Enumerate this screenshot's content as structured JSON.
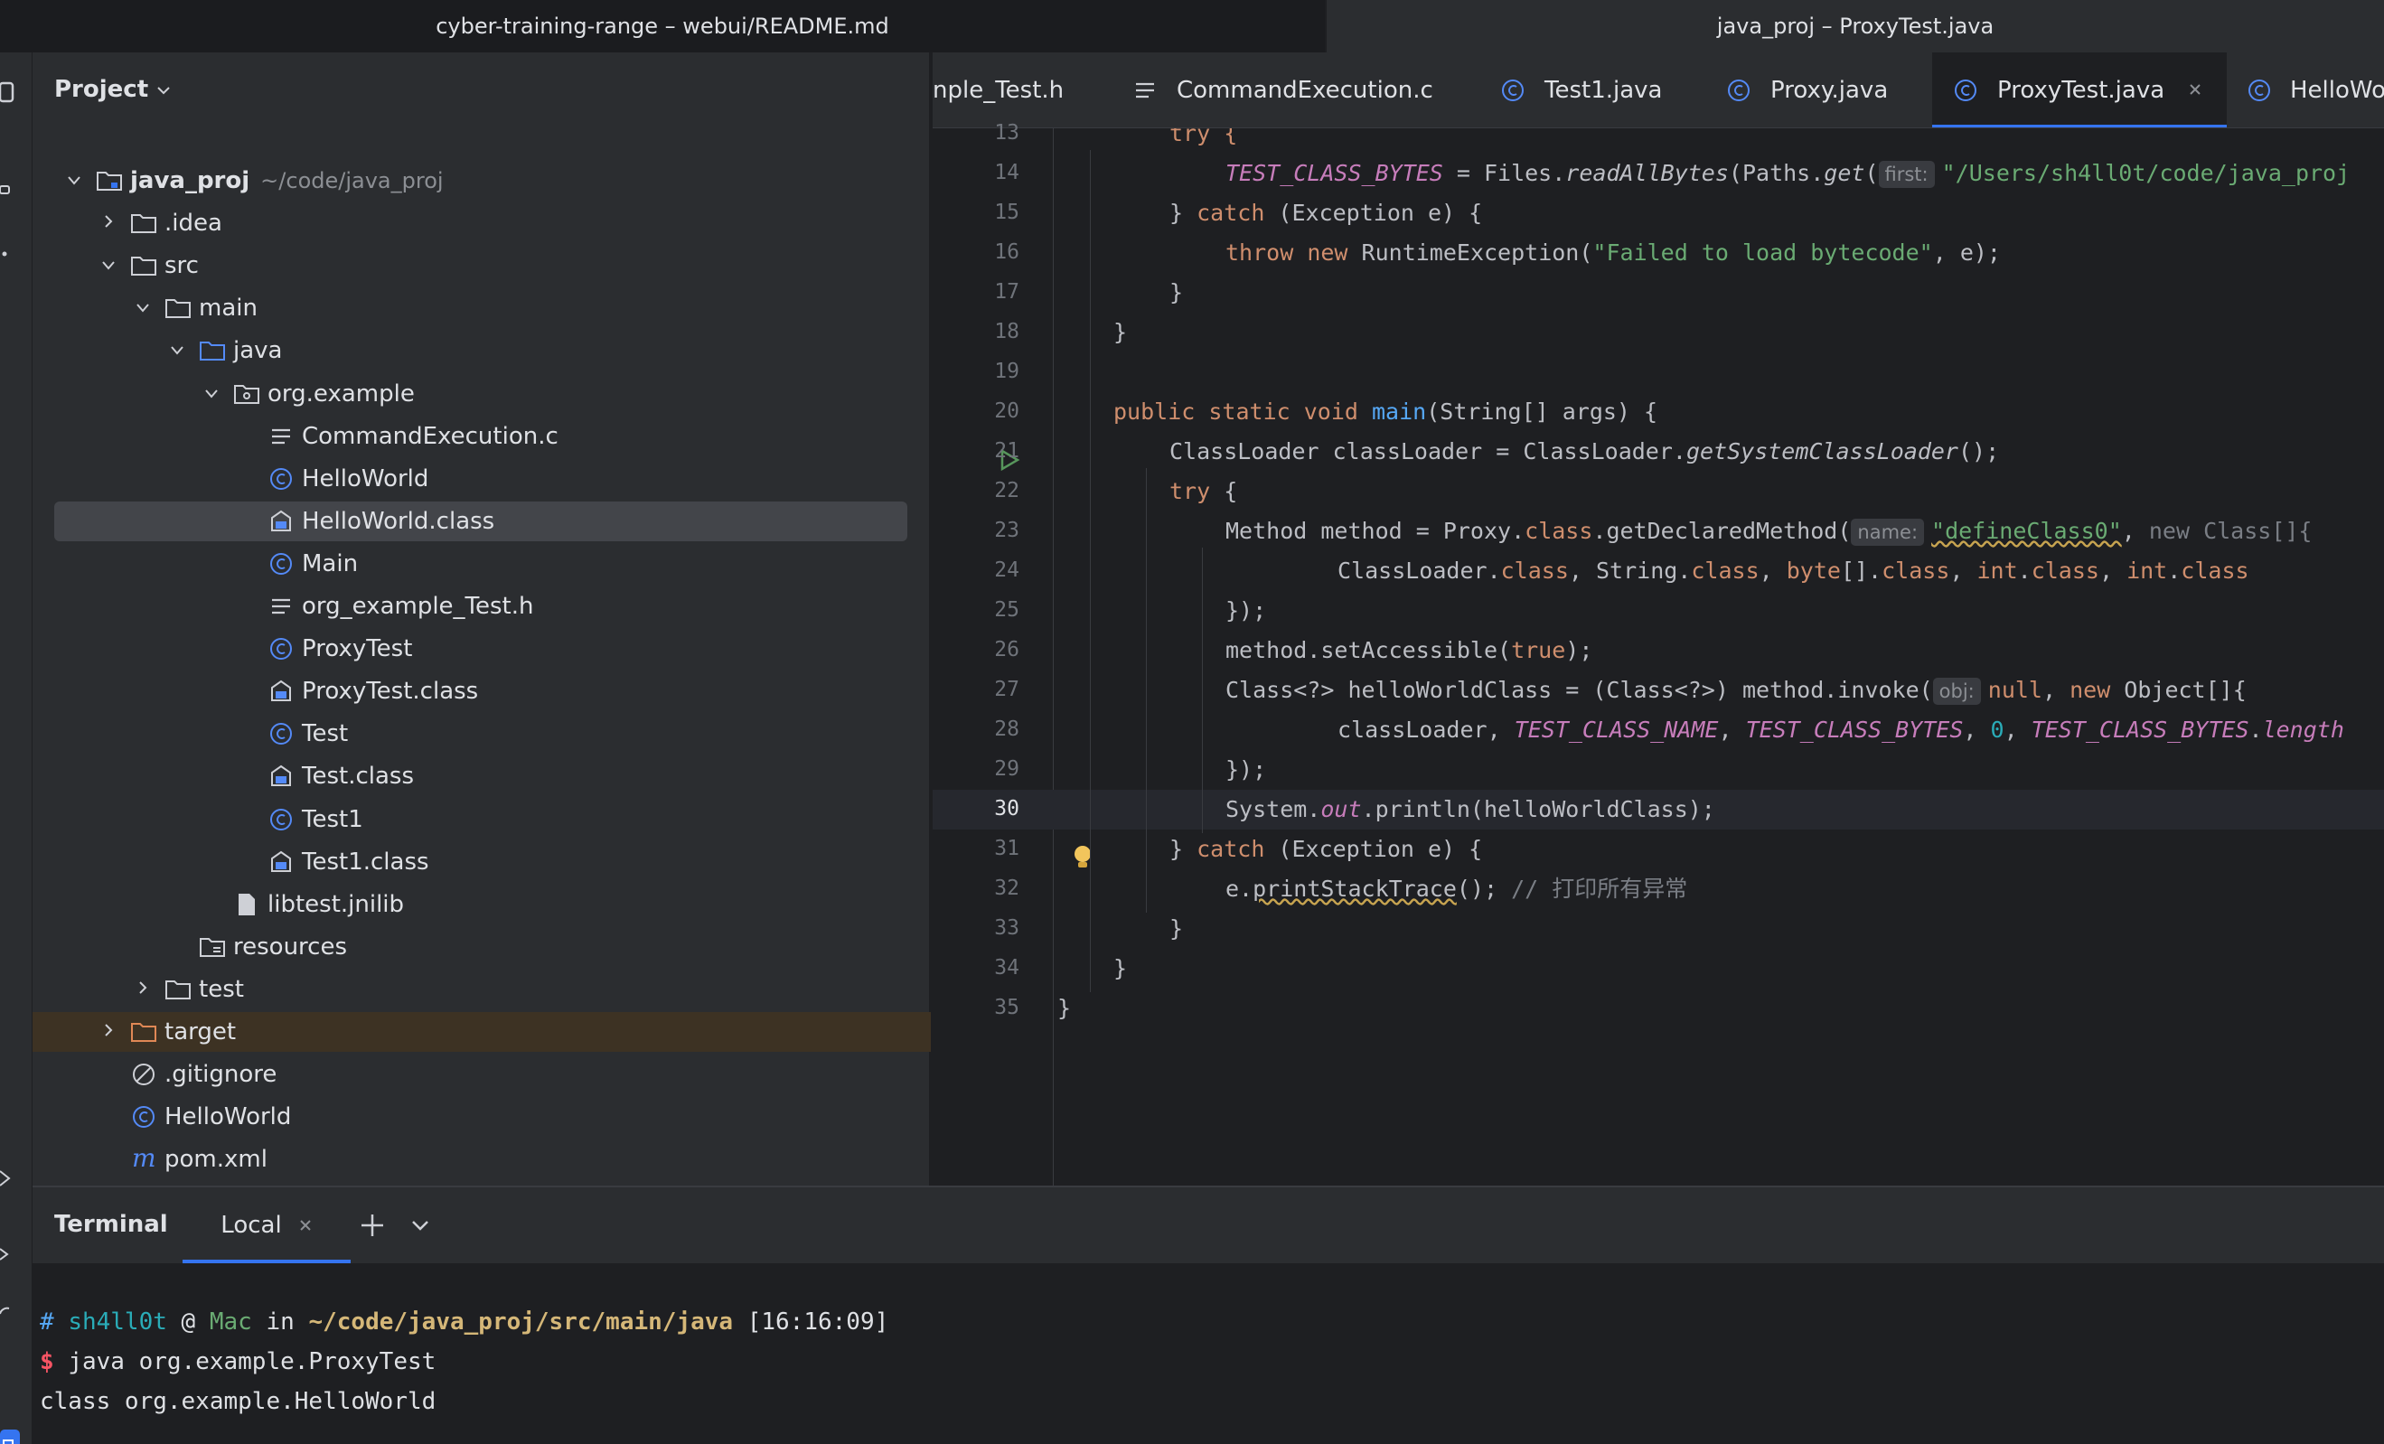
{
  "windows": {
    "left_title": "cyber-training-range – webui/README.md",
    "right_title": "java_proj – ProxyTest.java"
  },
  "project_panel": {
    "title": "Project",
    "tree": [
      {
        "label": "java_proj",
        "extra": "~/code/java_proj",
        "icon": "module-folder-icon",
        "chevron": "down",
        "indent": 0,
        "bold": true
      },
      {
        "label": ".idea",
        "icon": "folder-icon",
        "chevron": "right",
        "indent": 1
      },
      {
        "label": "src",
        "icon": "folder-icon",
        "chevron": "down",
        "indent": 1
      },
      {
        "label": "main",
        "icon": "folder-icon",
        "chevron": "down",
        "indent": 2
      },
      {
        "label": "java",
        "icon": "source-folder-icon",
        "chevron": "down",
        "indent": 3
      },
      {
        "label": "org.example",
        "icon": "package-icon",
        "chevron": "down",
        "indent": 4
      },
      {
        "label": "CommandExecution.c",
        "icon": "text-file-icon",
        "indent": 5
      },
      {
        "label": "HelloWorld",
        "icon": "java-class-icon",
        "indent": 5
      },
      {
        "label": "HelloWorld.class",
        "icon": "binary-class-icon",
        "indent": 5,
        "selected": true
      },
      {
        "label": "Main",
        "icon": "java-class-icon",
        "indent": 5
      },
      {
        "label": "org_example_Test.h",
        "icon": "text-file-icon",
        "indent": 5
      },
      {
        "label": "ProxyTest",
        "icon": "java-class-icon",
        "indent": 5
      },
      {
        "label": "ProxyTest.class",
        "icon": "binary-class-icon",
        "indent": 5
      },
      {
        "label": "Test",
        "icon": "java-class-icon",
        "indent": 5
      },
      {
        "label": "Test.class",
        "icon": "binary-class-icon",
        "indent": 5
      },
      {
        "label": "Test1",
        "icon": "java-class-icon",
        "indent": 5
      },
      {
        "label": "Test1.class",
        "icon": "binary-class-icon",
        "indent": 5
      },
      {
        "label": "libtest.jnilib",
        "icon": "file-icon",
        "indent": 4
      },
      {
        "label": "resources",
        "icon": "resources-folder-icon",
        "indent": 3
      },
      {
        "label": "test",
        "icon": "folder-icon",
        "chevron": "right",
        "indent": 2
      },
      {
        "label": "target",
        "icon": "excluded-folder-icon",
        "chevron": "right",
        "indent": 1,
        "highlight": true
      },
      {
        "label": ".gitignore",
        "icon": "ignore-file-icon",
        "indent": 1
      },
      {
        "label": "HelloWorld",
        "icon": "java-class-icon",
        "indent": 1
      },
      {
        "label": "pom.xml",
        "icon": "maven-icon",
        "indent": 1
      }
    ]
  },
  "editor": {
    "tabs": [
      {
        "label": "nple_Test.h",
        "icon": "none"
      },
      {
        "label": "CommandExecution.c",
        "icon": "text-file-icon"
      },
      {
        "label": "Test1.java",
        "icon": "java-class-icon"
      },
      {
        "label": "Proxy.java",
        "icon": "java-class-icon"
      },
      {
        "label": "ProxyTest.java",
        "icon": "java-class-icon",
        "active": true
      },
      {
        "label": "HelloWorld",
        "icon": "java-class-icon"
      }
    ],
    "current_line": "30",
    "line_numbers": [
      "13",
      "14",
      "15",
      "16",
      "17",
      "18",
      "19",
      "20",
      "21",
      "22",
      "23",
      "24",
      "25",
      "26",
      "27",
      "28",
      "29",
      "30",
      "31",
      "32",
      "33",
      "34",
      "35"
    ],
    "code": {
      "l13_try": "try {",
      "l14_field": "TEST_CLASS_BYTES",
      "l14_a": " = Files.",
      "l14_m1": "readAllBytes",
      "l14_b": "(Paths.",
      "l14_m2": "get",
      "l14_c": "(",
      "l14_hint": "first:",
      "l14_str": "\"/Users/sh4ll0t/code/java_proj",
      "l15_a": "} ",
      "l15_kw": "catch",
      "l15_b": " (Exception e) {",
      "l16_kw1": "throw",
      "l16_kw2": "new",
      "l16_a": " RuntimeException(",
      "l16_str": "\"Failed to load bytecode\"",
      "l16_b": ", e);",
      "l17": "}",
      "l18": "}",
      "l20_kw": "public static void",
      "l20_m": "main",
      "l20_b": "(String[] args) {",
      "l21_a": "ClassLoader classLoader = ClassLoader.",
      "l21_m": "getSystemClassLoader",
      "l21_b": "();",
      "l22_kw": "try",
      "l22_b": " {",
      "l23_a": "Method method = Proxy.",
      "l23_kw": "class",
      "l23_b": ".getDeclaredMethod(",
      "l23_hint": "name:",
      "l23_str": "\"defineClass0\"",
      "l23_c": ", ",
      "l23_kw2": "new",
      "l23_d": " Class[]{",
      "l24_a": "ClassLoader.",
      "l24_kw1": "class",
      "l24_b": ", String.",
      "l24_kw2": "class",
      "l24_c": ", ",
      "l24_kw3": "byte",
      "l24_d": "[].",
      "l24_kw4": "class",
      "l24_e": ", ",
      "l24_kw5": "int",
      "l24_f": ".",
      "l24_kw6": "class",
      "l24_g": ", ",
      "l24_kw7": "int",
      "l24_h": ".",
      "l24_kw8": "class",
      "l25": "});",
      "l26_a": "method.setAccessible(",
      "l26_kw": "true",
      "l26_b": ");",
      "l27_a": "Class<?> helloWorldClass = (Class<?>) method.invoke(",
      "l27_hint": "obj:",
      "l27_kw": "null",
      "l27_b": ", ",
      "l27_kw2": "new",
      "l27_c": " Object[]{",
      "l28_a": "classLoader, ",
      "l28_f1": "TEST_CLASS_NAME",
      "l28_b": ", ",
      "l28_f2": "TEST_CLASS_BYTES",
      "l28_c": ", ",
      "l28_num": "0",
      "l28_d": ", ",
      "l28_f3": "TEST_CLASS_BYTES",
      "l28_e": ".",
      "l28_f4": "length",
      "l29": "});",
      "l30_a": "System.",
      "l30_f": "out",
      "l30_b": ".println(helloWorldClass);",
      "l31_a": "} ",
      "l31_kw": "catch",
      "l31_b": " (Exception e) {",
      "l32_a": "e.",
      "l32_m": "printStackTrace",
      "l32_b": "(); ",
      "l32_cmt": "// 打印所有异常",
      "l33": "}",
      "l34": "}",
      "l35": "}"
    }
  },
  "terminal": {
    "title": "Terminal",
    "tab": "Local",
    "prompt": {
      "hash": "#",
      "user": "sh4ll0t",
      "at": "@",
      "host": "Mac",
      "in": "in",
      "path": "~/code/java_proj/src/main/java",
      "time": "[16:16:09]"
    },
    "dollar": "$",
    "command": "java org.example.ProxyTest",
    "output": "class org.example.HelloWorld"
  },
  "colors": {
    "accent": "#3574f0",
    "keyword": "#cf8e6d",
    "string": "#6aab73",
    "field": "#c77dbb",
    "method": "#56a8f5"
  }
}
